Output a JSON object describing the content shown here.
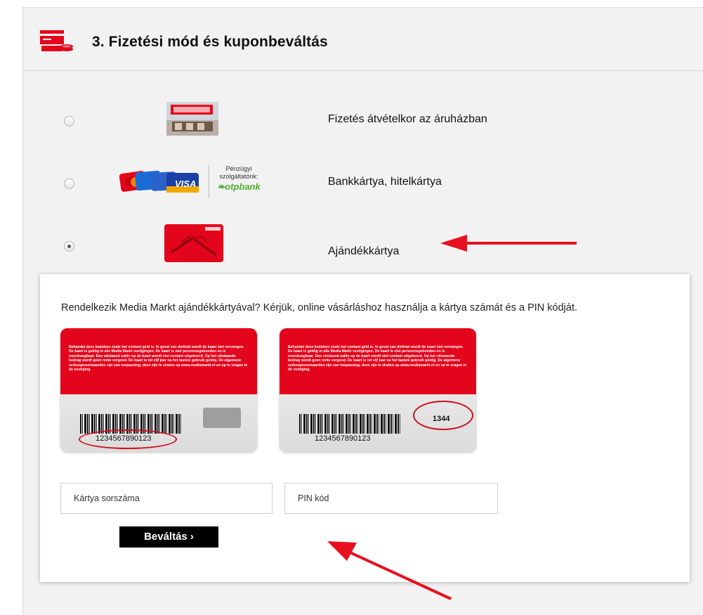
{
  "section": {
    "title": "3. Fizetési mód és kuponbeváltás",
    "icon": "payment-icon"
  },
  "payment_options": [
    {
      "label": "Fizetés átvételkor az áruházban",
      "logo": "store-logo",
      "selected": false
    },
    {
      "label": "Bankkártya, hitelkártya",
      "logo": "bank-cards-logo",
      "selected": false
    },
    {
      "label": "Ajándékkártya",
      "logo": "gift-card-logo",
      "selected": true
    }
  ],
  "bank_logo": {
    "partner_line1": "Pénzügyi",
    "partner_line2": "szolgáltatónk:",
    "bank_name": "otpbank",
    "visa": "VISA"
  },
  "gift_card": {
    "description": "Rendelkezik Media Markt ajándékkártyával? Kérjük, online vásárláshoz használja a kártya számát és a PIN kódját.",
    "card_fine_print": "Behandel deze kadobon zoals het contant geld is. In geval van diefstal wordt de kaart niet vervangen. De kaart is geldig in alle Media Markt vestigingen. De kaart is niet persoonsgebonden en is overdraagbaar. Een uitstaand saldo op de kaart wordt niet contant uitgekeerd. Op het uitstaande bedrag wordt geen rente vergoed. De kaart is tot vijf jaar na het laatste gebruik geldig. De algemene verkoopvoorwaarden zijn van toepassing; deze zijn te vinden op www.mediamarkt.nl en op te vragen in de vestiging.",
    "card_number_example": "1234567890123",
    "pin_example": "1344",
    "card_number_placeholder": "Kártya sorszáma",
    "pin_placeholder": "PIN kód",
    "redeem_label": "Beváltás ›"
  },
  "colors": {
    "accent": "#e3051b",
    "annotation": "#e8101e",
    "button": "#000000"
  }
}
